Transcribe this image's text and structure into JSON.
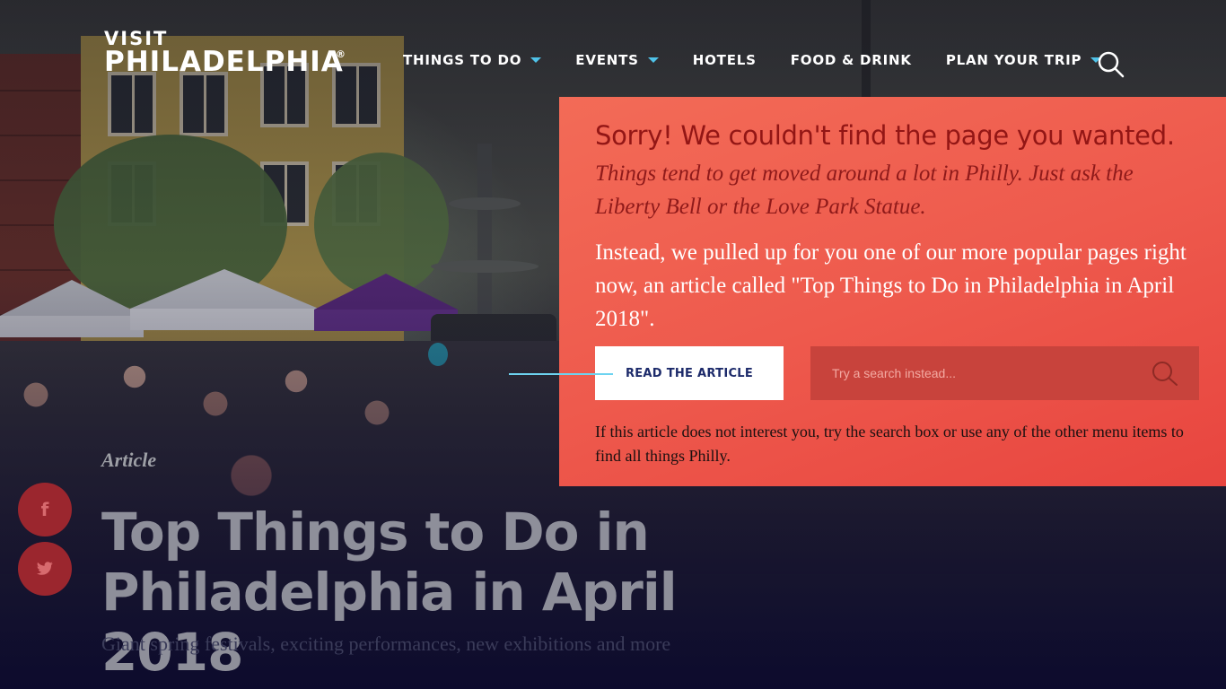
{
  "brand": {
    "visit": "VISIT",
    "name": "PHILADELPHIA",
    "reg": "®"
  },
  "nav": {
    "items": [
      {
        "label": "THINGS TO DO",
        "dropdown": true
      },
      {
        "label": "EVENTS",
        "dropdown": true
      },
      {
        "label": "HOTELS",
        "dropdown": false
      },
      {
        "label": "FOOD & DRINK",
        "dropdown": false
      },
      {
        "label": "PLAN YOUR TRIP",
        "dropdown": true
      }
    ],
    "search_icon": "search-icon"
  },
  "notice": {
    "title": "Sorry! We couldn't find the page you wanted.",
    "subtitle": "Things tend to get moved around a lot in Philly. Just ask the Liberty Bell or the Love Park Statue.",
    "body": "Instead, we pulled up for you one of our more popular pages right now, an article called \"Top Things to Do in Philadelphia in April 2018\".",
    "button_label": "READ THE ARTICLE",
    "search_placeholder": "Try a search instead...",
    "footnote": "If this article does not interest you, try the search box or use any of the other menu items to find all things Philly."
  },
  "article": {
    "kicker": "Article",
    "title": "Top Things to Do in Philadelphia in April 2018",
    "subtitle": "Giant spring festivals, exciting performances, new exhibitions and more"
  },
  "share": [
    {
      "icon": "facebook-icon",
      "glyph": "f"
    },
    {
      "icon": "twitter-icon",
      "glyph": "t"
    }
  ],
  "colors": {
    "panel": "#ee5a4d",
    "title": "#931615",
    "accent": "#4fc2e8",
    "button_text": "#1c2a6a",
    "share_bg": "#9b262e"
  }
}
